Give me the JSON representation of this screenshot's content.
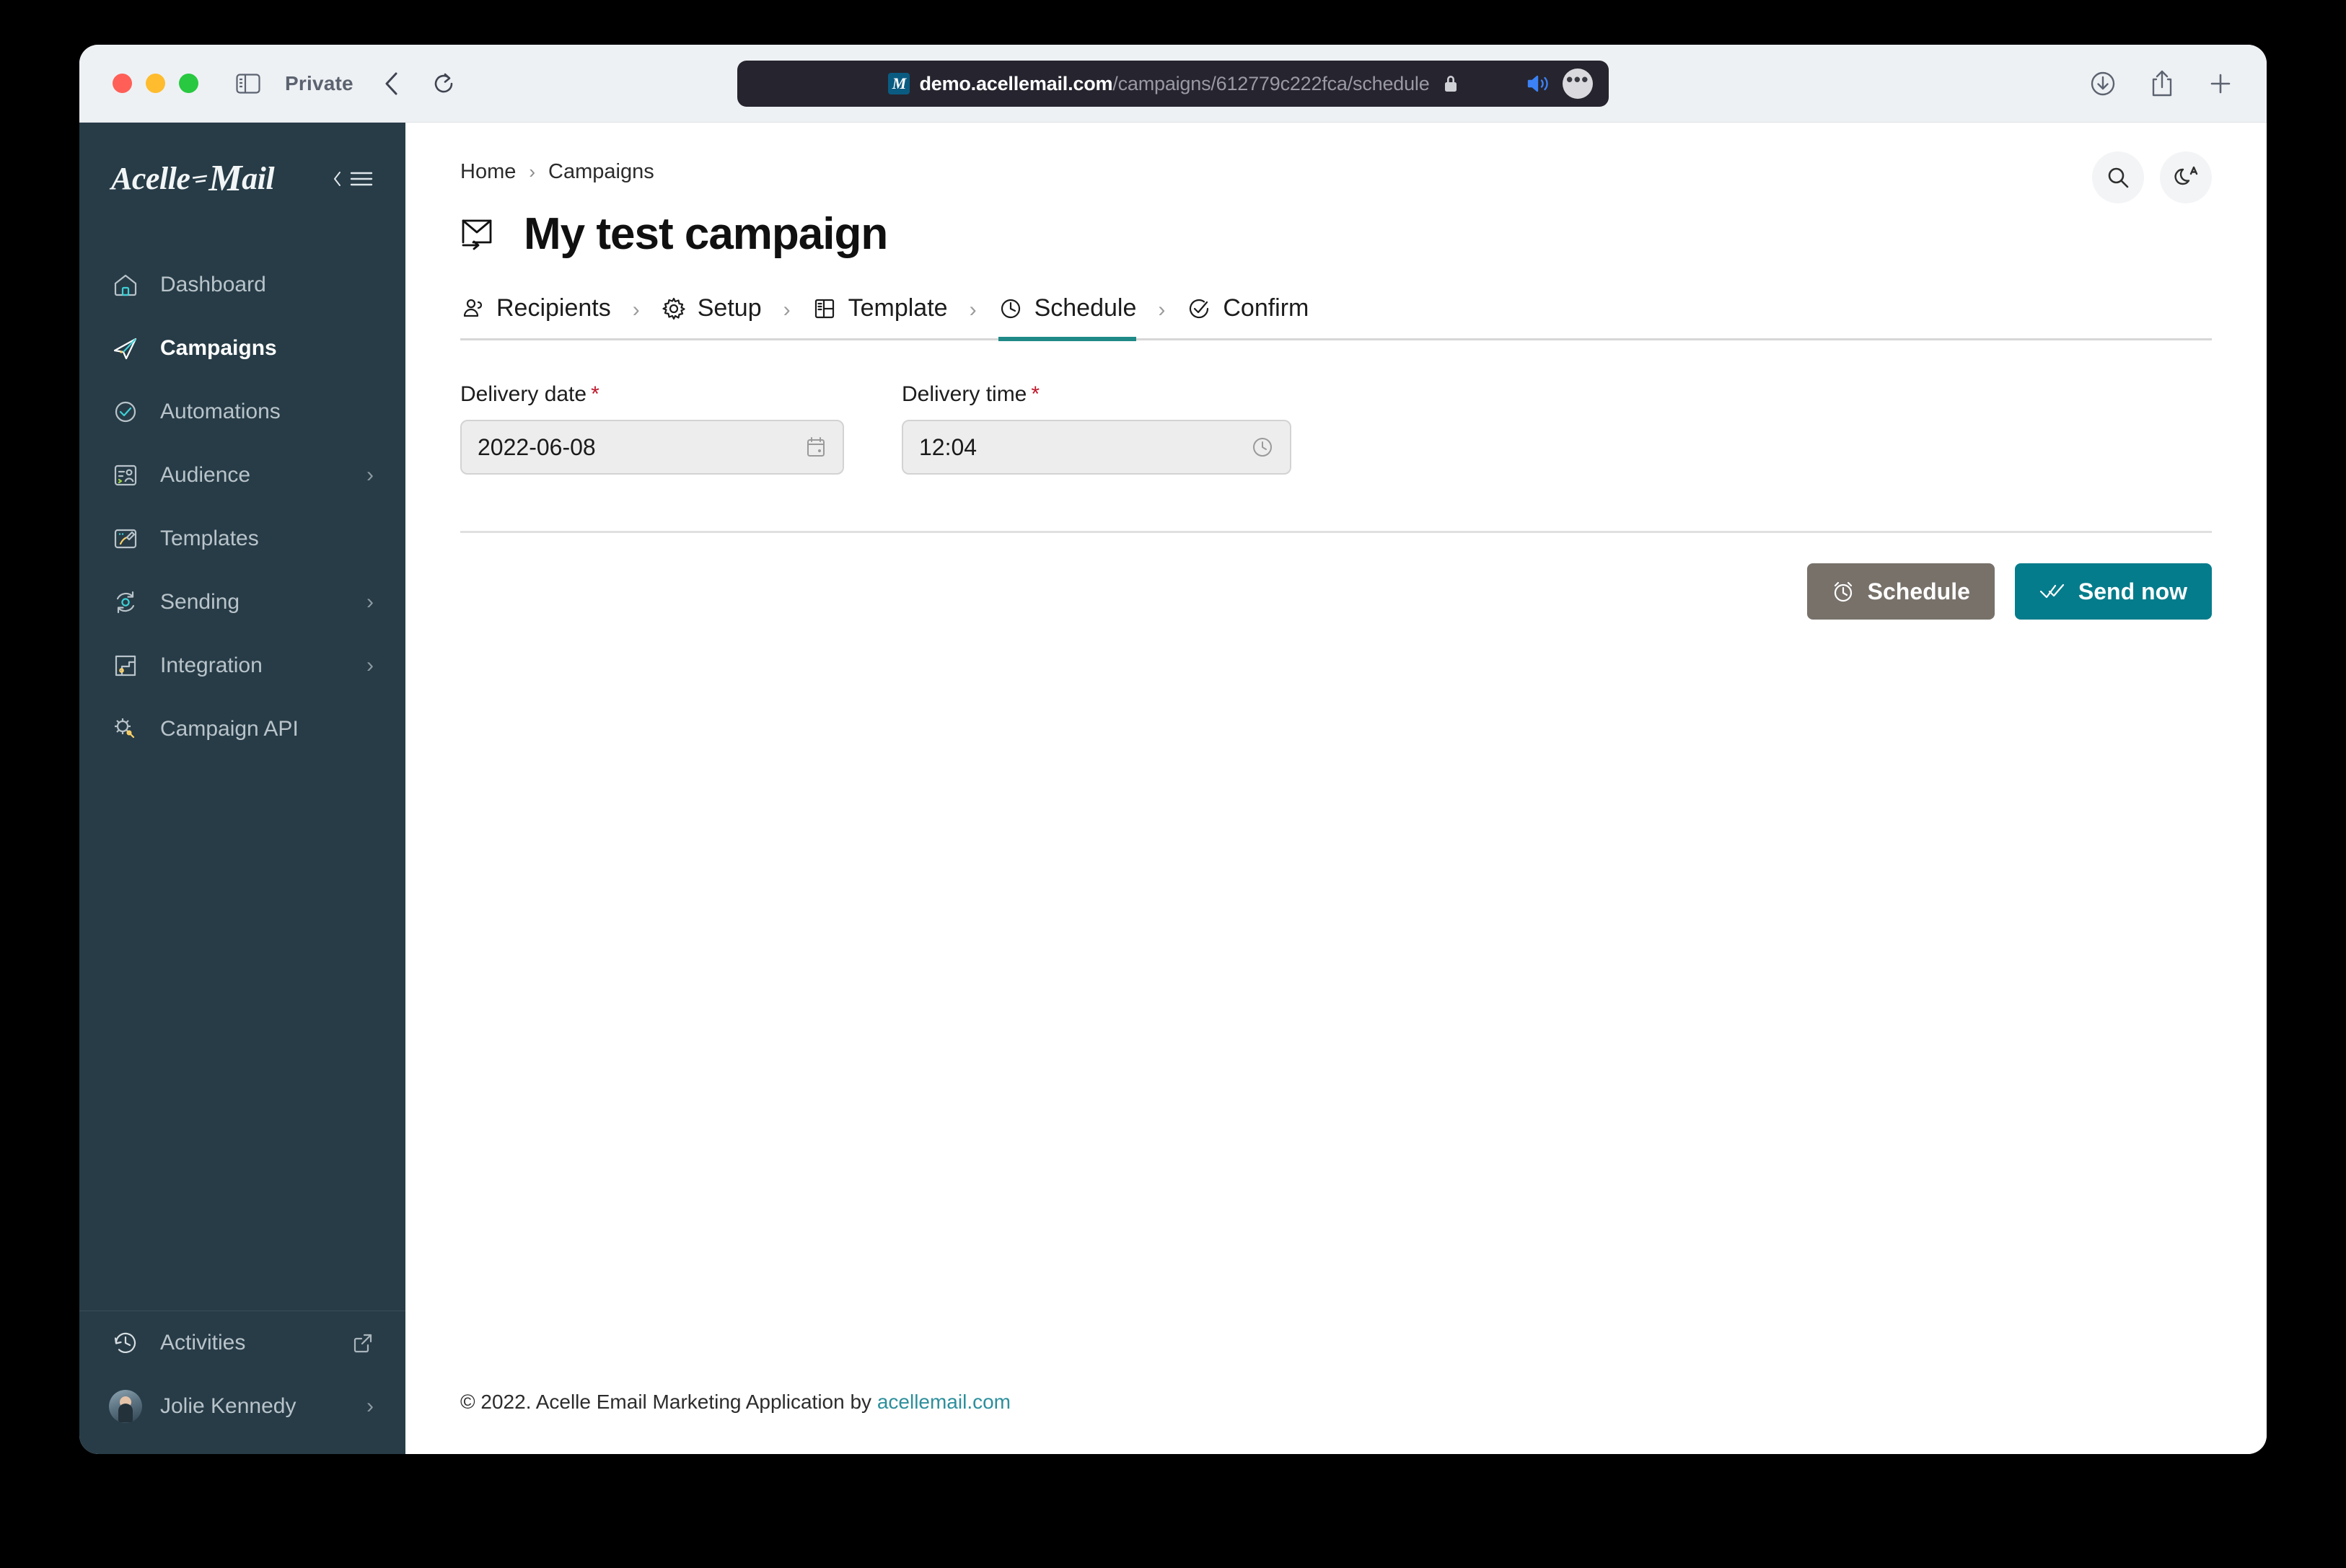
{
  "browser": {
    "private_label": "Private",
    "url_host": "demo.acellemail.com",
    "url_path": "/campaigns/612779c222fca/schedule",
    "favicon_letter": "M",
    "icons": {
      "sidebar": "sidebar-icon",
      "back": "back-chevron-icon",
      "reload": "reload-icon",
      "lock": "lock-icon",
      "speaker": "speaker-icon",
      "more": "more-options-icon",
      "download": "download-icon",
      "share": "share-icon",
      "new_tab": "new-tab-icon"
    }
  },
  "sidebar": {
    "brand_pre": "Acelle",
    "brand_m": "M",
    "brand_post": "ail",
    "items": [
      {
        "label": "Dashboard",
        "icon": "home-icon",
        "chevron": "",
        "active": false
      },
      {
        "label": "Campaigns",
        "icon": "paper-plane-icon",
        "chevron": "",
        "active": true
      },
      {
        "label": "Automations",
        "icon": "check-circle-icon",
        "chevron": "",
        "active": false
      },
      {
        "label": "Audience",
        "icon": "audience-icon",
        "chevron": "›",
        "active": false
      },
      {
        "label": "Templates",
        "icon": "template-icon",
        "chevron": "",
        "active": false
      },
      {
        "label": "Sending",
        "icon": "sending-icon",
        "chevron": "›",
        "active": false
      },
      {
        "label": "Integration",
        "icon": "integration-icon",
        "chevron": "›",
        "active": false
      },
      {
        "label": "Campaign API",
        "icon": "api-icon",
        "chevron": "",
        "active": false
      }
    ],
    "bottom": [
      {
        "label": "Activities",
        "icon": "history-icon",
        "chevron": ""
      },
      {
        "label": "Jolie Kennedy",
        "icon": "avatar",
        "chevron": "›"
      }
    ]
  },
  "header": {
    "breadcrumb": [
      "Home",
      "Campaigns"
    ],
    "breadcrumb_sep": "›",
    "title": "My test campaign",
    "title_icon": "mail-send-icon",
    "search_icon": "search-icon",
    "theme_icon": "dark-mode-auto-icon"
  },
  "steps": [
    {
      "label": "Recipients",
      "icon": "person-icon",
      "active": false
    },
    {
      "label": "Setup",
      "icon": "gear-icon",
      "active": false
    },
    {
      "label": "Template",
      "icon": "layout-icon",
      "active": false
    },
    {
      "label": "Schedule",
      "icon": "clock-icon",
      "active": true
    },
    {
      "label": "Confirm",
      "icon": "check-circle-icon",
      "active": false
    }
  ],
  "step_sep": "›",
  "form": {
    "date": {
      "label": "Delivery date",
      "required_marker": "*",
      "value": "2022-06-08",
      "icon": "calendar-icon"
    },
    "time": {
      "label": "Delivery time",
      "required_marker": "*",
      "value": "12:04",
      "icon": "clock-icon"
    }
  },
  "actions": {
    "schedule": {
      "label": "Schedule",
      "icon": "alarm-clock-icon",
      "color": "#77716a"
    },
    "send_now": {
      "label": "Send now",
      "icon": "double-check-icon",
      "color": "#057c8b"
    }
  },
  "footer": {
    "text": "© 2022. Acelle Email Marketing Application by ",
    "link": "acellemail.com"
  },
  "colors": {
    "sidebar_bg": "#273c47",
    "accent_teal": "#057c8b",
    "active_underline": "#1f8a87",
    "required_red": "#c0182b"
  }
}
